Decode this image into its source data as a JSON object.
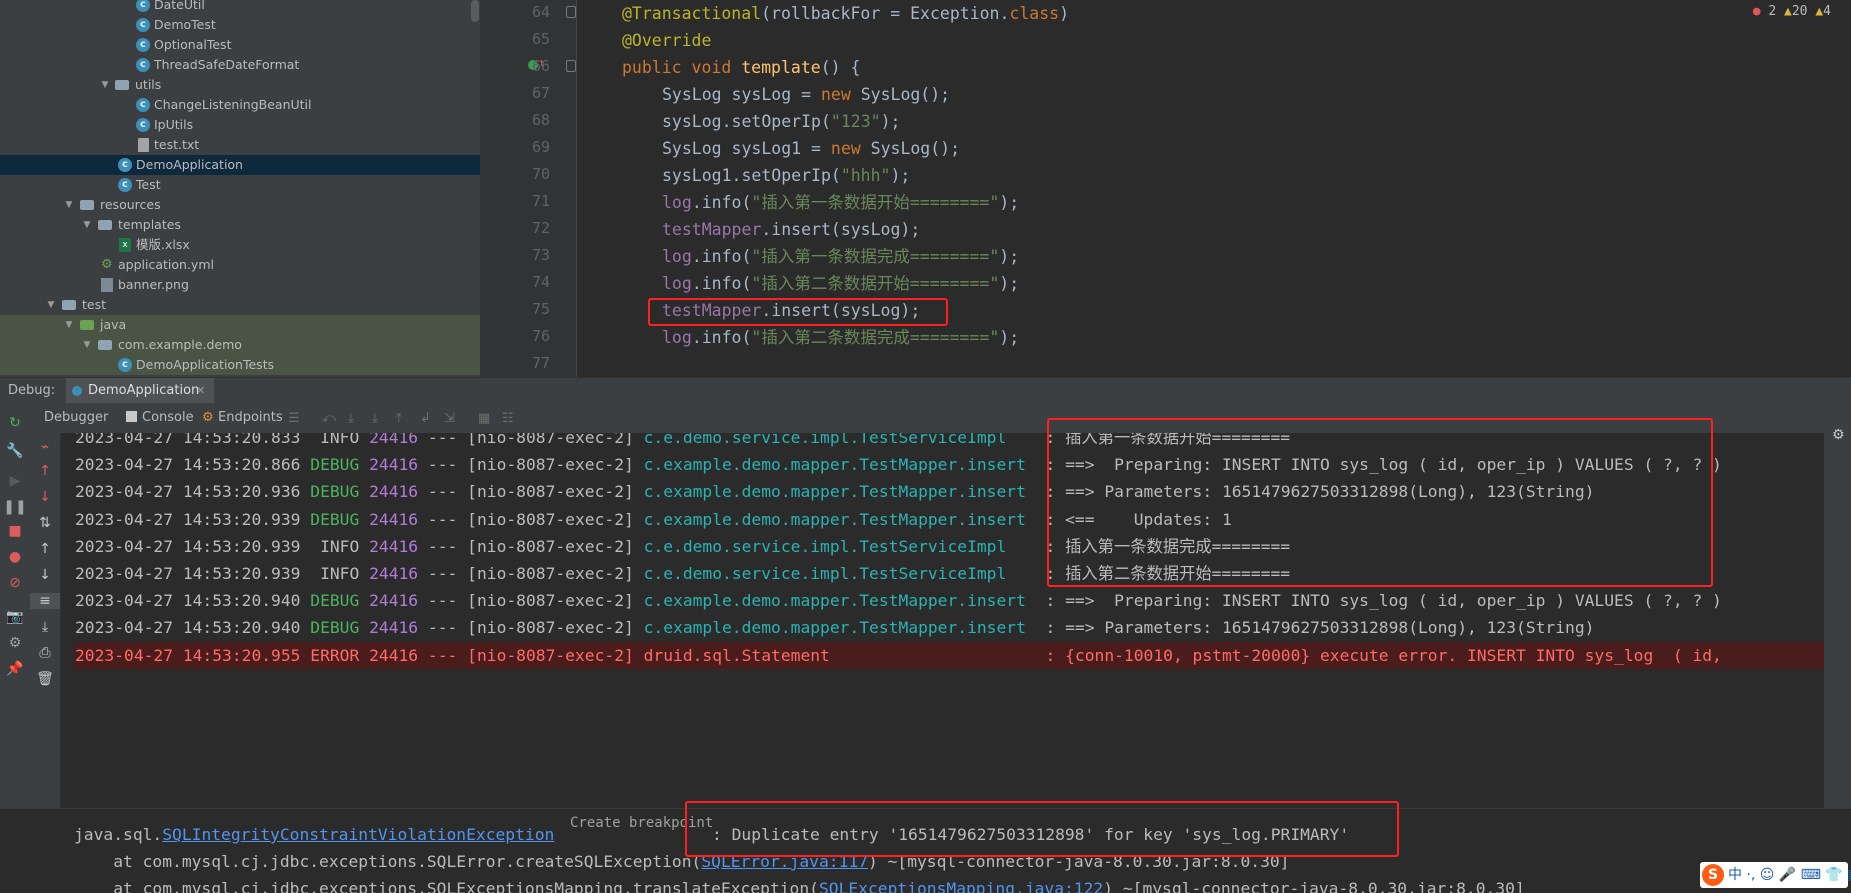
{
  "project_tree": {
    "items": [
      {
        "label": "DateUtil",
        "icon": "class-icon"
      },
      {
        "label": "DemoTest",
        "icon": "class-icon"
      },
      {
        "label": "OptionalTest",
        "icon": "class-icon"
      },
      {
        "label": "ThreadSafeDateFormat",
        "icon": "class-icon"
      },
      {
        "label": "utils",
        "icon": "folder-icon"
      },
      {
        "label": "ChangeListeningBeanUtil",
        "icon": "class-icon"
      },
      {
        "label": "IpUtils",
        "icon": "class-icon"
      },
      {
        "label": "test.txt",
        "icon": "text-file-icon"
      },
      {
        "label": "DemoApplication",
        "icon": "spring-class-icon"
      },
      {
        "label": "Test",
        "icon": "class-icon"
      },
      {
        "label": "resources",
        "icon": "resources-folder-icon"
      },
      {
        "label": "templates",
        "icon": "folder-icon"
      },
      {
        "label": "模版.xlsx",
        "icon": "excel-file-icon"
      },
      {
        "label": "application.yml",
        "icon": "yaml-file-icon"
      },
      {
        "label": "banner.png",
        "icon": "image-file-icon"
      },
      {
        "label": "test",
        "icon": "folder-icon"
      },
      {
        "label": "java",
        "icon": "test-source-folder-icon"
      },
      {
        "label": "com.example.demo",
        "icon": "package-icon"
      },
      {
        "label": "DemoApplicationTests",
        "icon": "class-icon"
      }
    ]
  },
  "editor": {
    "inspections": {
      "errors": "2",
      "warnings": "20",
      "weak": "4"
    },
    "line_numbers": [
      "64",
      "65",
      "66",
      "67",
      "68",
      "69",
      "70",
      "71",
      "72",
      "73",
      "74",
      "75",
      "76",
      "77"
    ],
    "lines": {
      "l64a": "@Transactional",
      "l64b": "(rollbackFor = Exception.",
      "l64c": "class",
      "l64d": ")",
      "l65": "@Override",
      "l66a": "public void ",
      "l66b": "template",
      "l66c": "() {",
      "l67a": "SysLog sysLog = ",
      "l67b": "new ",
      "l67c": "SysLog();",
      "l68a": "sysLog.setOperIp(",
      "l68b": "\"123\"",
      "l68c": ");",
      "l69a": "SysLog sysLog1 = ",
      "l69b": "new ",
      "l69c": "SysLog();",
      "l70a": "sysLog1.setOperIp(",
      "l70b": "\"hhh\"",
      "l70c": ");",
      "l71a": "log",
      "l71b": ".info(",
      "l71c": "\"插入第一条数据开始========\"",
      "l71d": ");",
      "l72a": "testMapper",
      "l72b": ".insert(sysLog);",
      "l73a": "log",
      "l73b": ".info(",
      "l73c": "\"插入第一条数据完成========\"",
      "l73d": ");",
      "l74a": "log",
      "l74b": ".info(",
      "l74c": "\"插入第二条数据开始========\"",
      "l74d": ");",
      "l75a": "testMapper",
      "l75b": ".insert(sysLog);",
      "l76a": "log",
      "l76b": ".info(",
      "l76c": "\"插入第二条数据完成========\"",
      "l76d": ");"
    }
  },
  "debug": {
    "label": "Debug:",
    "session_tab": "DemoApplication",
    "tabs": {
      "debugger": "Debugger",
      "console": "Console",
      "endpoints": "Endpoints"
    }
  },
  "console": {
    "lines": [
      {
        "date": "2023-04-27 14:53:20.833",
        "level": " INFO",
        "pid": "24416",
        "sep": "---",
        "thread": "[nio-8087-exec-2]",
        "logger": "c.e.demo.service.impl.TestServiceImpl   ",
        "msg": ": 插入第一条数据开始========"
      },
      {
        "date": "2023-04-27 14:53:20.866",
        "level": "DEBUG",
        "pid": "24416",
        "sep": "---",
        "thread": "[nio-8087-exec-2]",
        "logger": "c.example.demo.mapper.TestMapper.insert ",
        "msg": ": ==>  Preparing: INSERT INTO sys_log ( id, oper_ip ) VALUES ( ?, ? )"
      },
      {
        "date": "2023-04-27 14:53:20.936",
        "level": "DEBUG",
        "pid": "24416",
        "sep": "---",
        "thread": "[nio-8087-exec-2]",
        "logger": "c.example.demo.mapper.TestMapper.insert ",
        "msg": ": ==> Parameters: 1651479627503312898(Long), 123(String)"
      },
      {
        "date": "2023-04-27 14:53:20.939",
        "level": "DEBUG",
        "pid": "24416",
        "sep": "---",
        "thread": "[nio-8087-exec-2]",
        "logger": "c.example.demo.mapper.TestMapper.insert ",
        "msg": ": <==    Updates: 1"
      },
      {
        "date": "2023-04-27 14:53:20.939",
        "level": " INFO",
        "pid": "24416",
        "sep": "---",
        "thread": "[nio-8087-exec-2]",
        "logger": "c.e.demo.service.impl.TestServiceImpl   ",
        "msg": ": 插入第一条数据完成========"
      },
      {
        "date": "2023-04-27 14:53:20.939",
        "level": " INFO",
        "pid": "24416",
        "sep": "---",
        "thread": "[nio-8087-exec-2]",
        "logger": "c.e.demo.service.impl.TestServiceImpl   ",
        "msg": ": 插入第二条数据开始========"
      },
      {
        "date": "2023-04-27 14:53:20.940",
        "level": "DEBUG",
        "pid": "24416",
        "sep": "---",
        "thread": "[nio-8087-exec-2]",
        "logger": "c.example.demo.mapper.TestMapper.insert ",
        "msg": ": ==>  Preparing: INSERT INTO sys_log ( id, oper_ip ) VALUES ( ?, ? )"
      },
      {
        "date": "2023-04-27 14:53:20.940",
        "level": "DEBUG",
        "pid": "24416",
        "sep": "---",
        "thread": "[nio-8087-exec-2]",
        "logger": "c.example.demo.mapper.TestMapper.insert ",
        "msg": ": ==> Parameters: 1651479627503312898(Long), 123(String)"
      },
      {
        "date": "2023-04-27 14:53:20.955",
        "level": "ERROR",
        "pid": "24416",
        "sep": "---",
        "thread": "[nio-8087-exec-2]",
        "logger": "druid.sql.Statement                     ",
        "msg": ": {conn-10010, pstmt-20000} execute error. INSERT INTO sys_log  ( id,"
      }
    ]
  },
  "exception": {
    "prefix": "java.sql.",
    "class_link": "SQLIntegrityConstraintViolationException",
    "create_breakpoint": "Create breakpoint",
    "message": ": Duplicate entry '1651479627503312898' for key 'sys_log.PRIMARY'",
    "frame1_a": "    at com.mysql.cj.jdbc.exceptions.SQLError.createSQLException(",
    "frame1_link": "SQLError.java:117",
    "frame1_b": ") ~[mysql-connector-java-8.0.30.jar:8.0.30]",
    "frame2_a": "    at com.mysql.cj.jdbc.exceptions.SQLExceptionsMapping.translateException(",
    "frame2_link": "SQLExceptionsMapping.java:122",
    "frame2_b": ") ~[mysql-connector-java-8.0.30.jar:8.0.30]"
  },
  "ime": {
    "label": "中 ·, ☺ 🎤 ⌨ 👕 ▦"
  }
}
